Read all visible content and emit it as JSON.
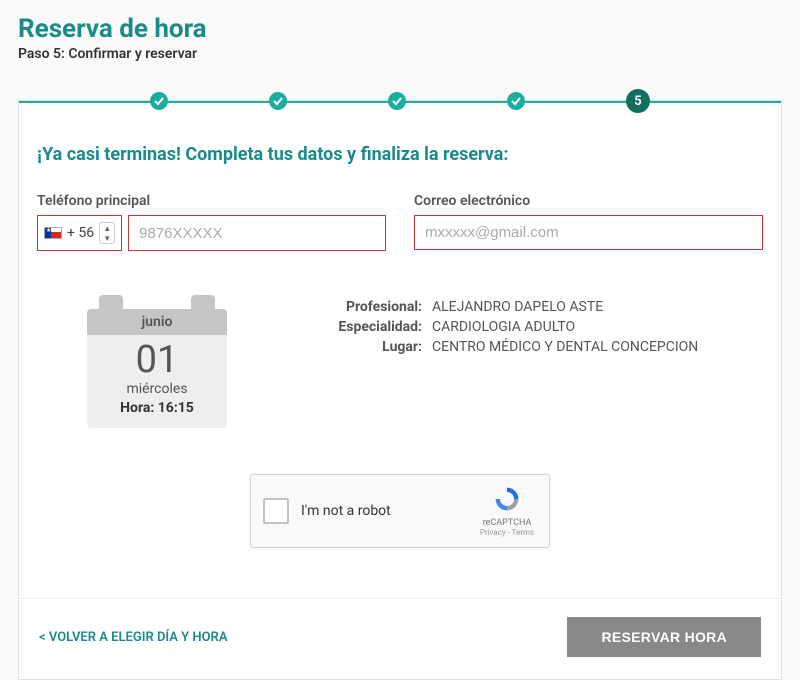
{
  "header": {
    "title": "Reserva de hora",
    "subtitle": "Paso 5: Confirmar y reservar"
  },
  "progress": {
    "current_step": "5"
  },
  "prompt": "¡Ya casi terminas! Completa tus datos y finaliza la reserva:",
  "fields": {
    "phone": {
      "label": "Teléfono principal",
      "country_code": "+ 56",
      "placeholder": "9876XXXXX",
      "value": ""
    },
    "email": {
      "label": "Correo electrónico",
      "placeholder": "mxxxxx@gmail.com",
      "value": ""
    }
  },
  "calendar": {
    "month": "junio",
    "day": "01",
    "weekday": "miércoles",
    "time_label": "Hora: 16:15"
  },
  "details": {
    "profesional_label": "Profesional:",
    "profesional_value": "ALEJANDRO DAPELO ASTE",
    "especialidad_label": "Especialidad:",
    "especialidad_value": "CARDIOLOGIA ADULTO",
    "lugar_label": "Lugar:",
    "lugar_value": "CENTRO MÉDICO Y DENTAL CONCEPCION"
  },
  "captcha": {
    "label": "I'm not a robot",
    "brand": "reCAPTCHA",
    "legal": "Privacy - Terms"
  },
  "footer": {
    "back": "< VOLVER A ELEGIR DÍA Y HORA",
    "reserve": "RESERVAR HORA"
  }
}
